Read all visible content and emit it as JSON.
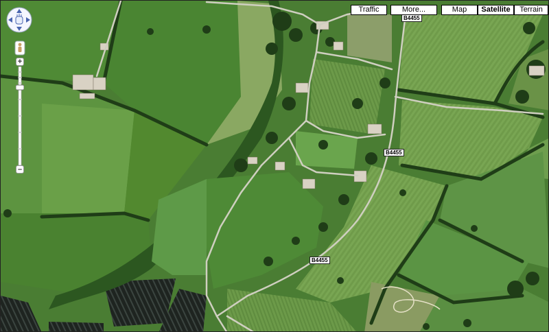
{
  "map_type_buttons": {
    "traffic": "Traffic",
    "more": "More...",
    "map": "Map",
    "satellite": "Satellite",
    "terrain": "Terrain",
    "active": "Satellite"
  },
  "road_labels": [
    "B4455",
    "B4455",
    "B4455"
  ],
  "zoom": {
    "plus": "+",
    "minus": "–",
    "level_fraction": 0.2
  },
  "colors": {
    "field_dark": "#3e7a2e",
    "field_light": "#6fa24e",
    "tree_dark": "#1f3d17",
    "road": "#c9c9b8",
    "ploughed": "#2a2f2c"
  }
}
